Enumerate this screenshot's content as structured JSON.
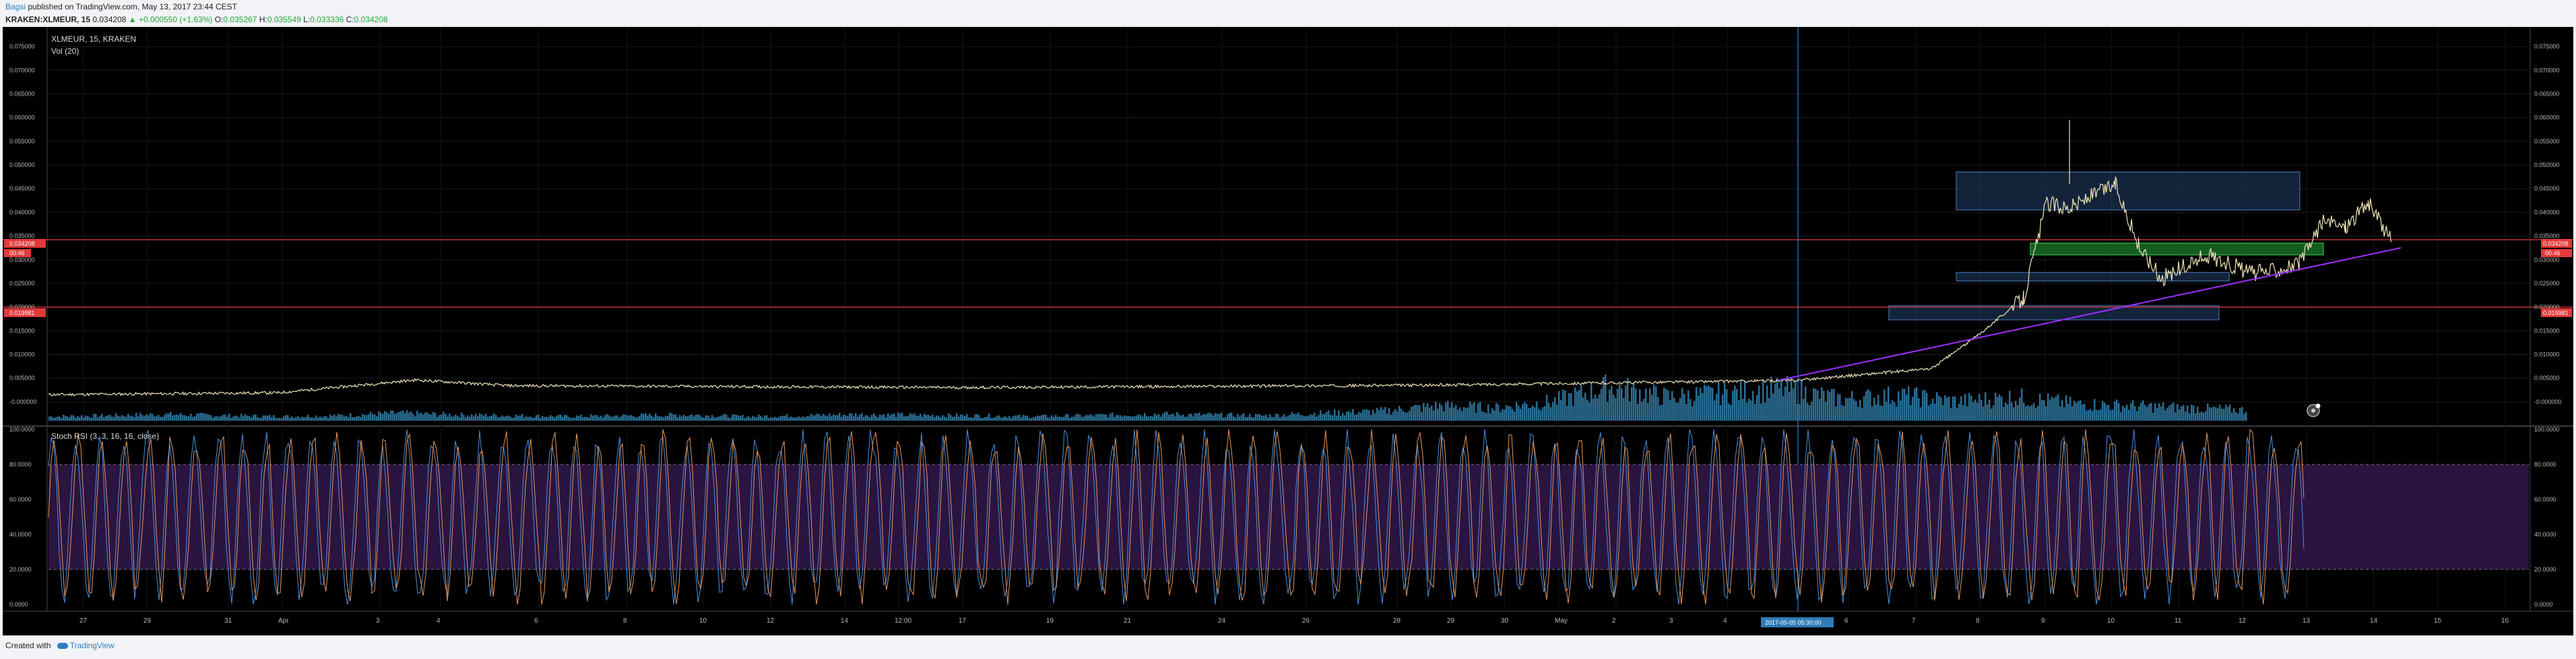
{
  "header": {
    "author": "Bagsi",
    "published_text": "published on TradingView.com, May 13, 2017 23:44 CEST",
    "symbol": "KRAKEN:XLMEUR, 15",
    "last": "0.034208",
    "change": "▲ +0.000550 (+1.63%)",
    "o_label": "O:",
    "o_value": "0.035267",
    "h_label": "H:",
    "h_value": "0.035549",
    "l_label": "L:",
    "l_value": "0.033336",
    "c_label": "C:",
    "c_value": "0.034208"
  },
  "legend": {
    "main": "XLMEUR, 15, KRAKEN",
    "vol": "Vol (20)",
    "rsi": "Stoch RSI (3, 3, 16, 16, close)"
  },
  "badges": {
    "last_price": "0.034208",
    "countdown": "00:46",
    "level": "0.019981",
    "cursor_time": "2017-05-05 05:30:00"
  },
  "footer": {
    "created_with": "Created with",
    "brand": "TradingView"
  },
  "colors": {
    "background": "#000000",
    "price_line": "#f2e6b8",
    "volume": "#2a6f95",
    "trendline": "#9b30ff",
    "level_line": "#e23a3a",
    "blue_box": "#23406a",
    "green_box": "#26a83a",
    "rsi_k": "#4a8fe0",
    "rsi_d": "#e8965a",
    "rsi_band": "#2a1440"
  },
  "chart_data": {
    "type": "line",
    "title": "XLMEUR, 15, KRAKEN",
    "price_axis": {
      "ylim": [
        -0.004,
        0.078
      ],
      "ticks": [
        "0.075000",
        "0.070000",
        "0.065000",
        "0.060000",
        "0.055000",
        "0.050000",
        "0.045000",
        "0.040000",
        "0.035000",
        "0.030000",
        "0.025000",
        "0.020000",
        "0.015000",
        "0.010000",
        "0.005000",
        "-0.000000"
      ]
    },
    "x_ticks": [
      "27",
      "29",
      "31",
      "Apr",
      "3",
      "4",
      "6",
      "8",
      "10",
      "12",
      "14",
      "12:00",
      "17",
      "19",
      "21",
      "24",
      "26",
      "28",
      "29",
      "30",
      "May",
      "2",
      "3",
      "4",
      "6",
      "7",
      "8",
      "9",
      "10",
      "11",
      "12",
      "13",
      "14",
      "15",
      "16"
    ],
    "price_series": [
      {
        "day": 0,
        "close": 0.0015
      },
      {
        "day": 5,
        "close": 0.0019
      },
      {
        "day": 8,
        "close": 0.0046
      },
      {
        "day": 10,
        "close": 0.0034
      },
      {
        "day": 20,
        "close": 0.003
      },
      {
        "day": 30,
        "close": 0.0035
      },
      {
        "day": 38,
        "close": 0.0045
      },
      {
        "day": 41,
        "close": 0.007
      },
      {
        "day": 42,
        "close": 0.014
      },
      {
        "day": 43,
        "close": 0.022
      },
      {
        "day": 43.5,
        "close": 0.042
      },
      {
        "day": 44,
        "close": 0.041
      },
      {
        "day": 45,
        "close": 0.046
      },
      {
        "day": 45.5,
        "close": 0.033
      },
      {
        "day": 46,
        "close": 0.026
      },
      {
        "day": 47,
        "close": 0.031
      },
      {
        "day": 48,
        "close": 0.027
      },
      {
        "day": 49,
        "close": 0.029
      },
      {
        "day": 49.5,
        "close": 0.038
      },
      {
        "day": 50,
        "close": 0.037
      },
      {
        "day": 50.5,
        "close": 0.042
      },
      {
        "day": 51,
        "close": 0.0342
      }
    ],
    "horizontal_levels": [
      0.034208,
      0.019981
    ],
    "volume_axis": {
      "ylim": [
        0,
        1
      ]
    },
    "volume_series": [
      0.1,
      0.12,
      0.15,
      0.12,
      0.1,
      0.12,
      0.18,
      0.14,
      0.12,
      0.1,
      0.12,
      0.14,
      0.1,
      0.12,
      0.15,
      0.13,
      0.12,
      0.1,
      0.12,
      0.16,
      0.14,
      0.12,
      0.18,
      0.22,
      0.35,
      0.3,
      0.45,
      0.8,
      0.55,
      0.65,
      0.75,
      0.5,
      0.6,
      0.45,
      0.55,
      0.4,
      0.35,
      0.3,
      0.25
    ],
    "stoch_rsi": {
      "ylim": [
        0,
        100
      ],
      "ticks": [
        "100.0000",
        "80.0000",
        "60.0000",
        "40.0000",
        "20.0000",
        "0.0000"
      ],
      "upper_band": 80,
      "lower_band": 20
    }
  }
}
